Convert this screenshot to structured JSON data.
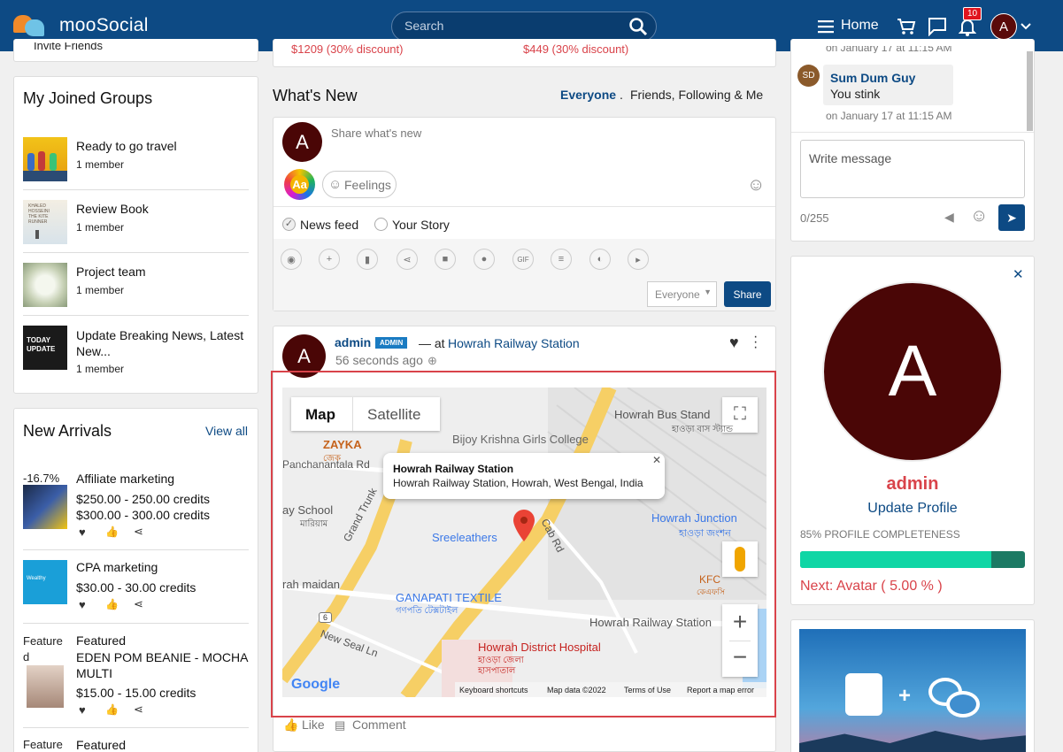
{
  "header": {
    "brand": "mooSocial",
    "search_placeholder": "Search",
    "home_label": "Home",
    "notification_count": "10",
    "avatar_letter": "A"
  },
  "left": {
    "top_link": "Invite Friends",
    "groups_title": "My Joined Groups",
    "groups": [
      {
        "name": "Ready to go travel",
        "members": "1 member"
      },
      {
        "name": "Review Book",
        "members": "1 member"
      },
      {
        "name": "Project team",
        "members": "1 member"
      },
      {
        "name": "Update Breaking News, Latest New...",
        "members": "1 member"
      }
    ],
    "arrivals_title": "New Arrivals",
    "view_all": "View all",
    "products": [
      {
        "tag": "-16.7%",
        "name": "Affiliate marketing",
        "price1": "$250.00 - 250.00 credits",
        "price2": "$300.00 - 300.00 credits"
      },
      {
        "tag": "",
        "name": "CPA marketing",
        "price1": "$30.00 - 30.00 credits",
        "price2": ""
      },
      {
        "tag": "Feature d",
        "featured": "Featured",
        "name": "EDEN POM BEANIE - MOCHA MULTI",
        "price1": "$15.00 - 15.00 credits",
        "price2": ""
      },
      {
        "tag": "Feature",
        "featured": "Featured"
      }
    ]
  },
  "center": {
    "top_prices": [
      "$1209 (30% discount)",
      "$449 (30% discount)"
    ],
    "whats_new": "What's New",
    "filter_everyone": "Everyone",
    "filter_sep": ".",
    "filter_friends": "Friends, Following & Me",
    "composer_avatar": "A",
    "composer_placeholder": "Share what's new",
    "aa_label": "Aa",
    "feelings_label": "Feelings",
    "news_feed": "News feed",
    "your_story": "Your Story",
    "privacy_select": "Everyone",
    "share_button": "Share",
    "post": {
      "avatar": "A",
      "author": "admin",
      "role_badge": "ADMIN",
      "at_text": "— at",
      "location": "Howrah Railway Station",
      "time": "56 seconds ago"
    },
    "map": {
      "tab_map": "Map",
      "tab_satellite": "Satellite",
      "popup_title": "Howrah Railway Station",
      "popup_address": "Howrah Railway Station, Howrah, West Bengal, India",
      "labels": [
        "Howrah Bus Stand",
        "হাওড়া বাস স্ট্যান্ড",
        "Bijoy Krishna Girls College",
        "ZAYKA",
        "জেক",
        "Panchanantala Rd",
        "ay School",
        "মারিয়াম",
        "Grand Trunk",
        "Sreeleathers",
        "Cab Rd",
        "Howrah Junction",
        "হাওড়া জংশন",
        "KFC",
        "কেএফসি",
        "rah maidan",
        "GANAPATI TEXTILE",
        "গণপতি টেক্সটাইল",
        "Howrah Railway Station",
        "New Seal Ln",
        "Howrah District Hospital",
        "হাওড়া জেলা",
        "হাসপাতাল",
        "6"
      ],
      "google": "Google",
      "footer": [
        "Keyboard shortcuts",
        "Map data ©2022",
        "Terms of Use",
        "Report a map error"
      ]
    },
    "like_label": "Like",
    "comment_label": "Comment"
  },
  "right": {
    "chat_meta_top": "on January 17 at 11:15 AM",
    "chat_avatar": "SD",
    "chat_name": "Sum Dum Guy",
    "chat_text": "You stink",
    "chat_time": "on January 17 at 11:15 AM",
    "message_placeholder": "Write message",
    "char_count": "0/255",
    "profile_letter": "A",
    "profile_name": "admin",
    "update_profile": "Update Profile",
    "completeness_label": "85% PROFILE COMPLETENESS",
    "completeness": 0.85,
    "next_step": "Next: Avatar ( 5.00 % )"
  },
  "colors": {
    "nav": "#0d4a84",
    "accent_red": "#d9434a",
    "progress": "#0fd6a5",
    "profile_bg": "#4a0606"
  }
}
